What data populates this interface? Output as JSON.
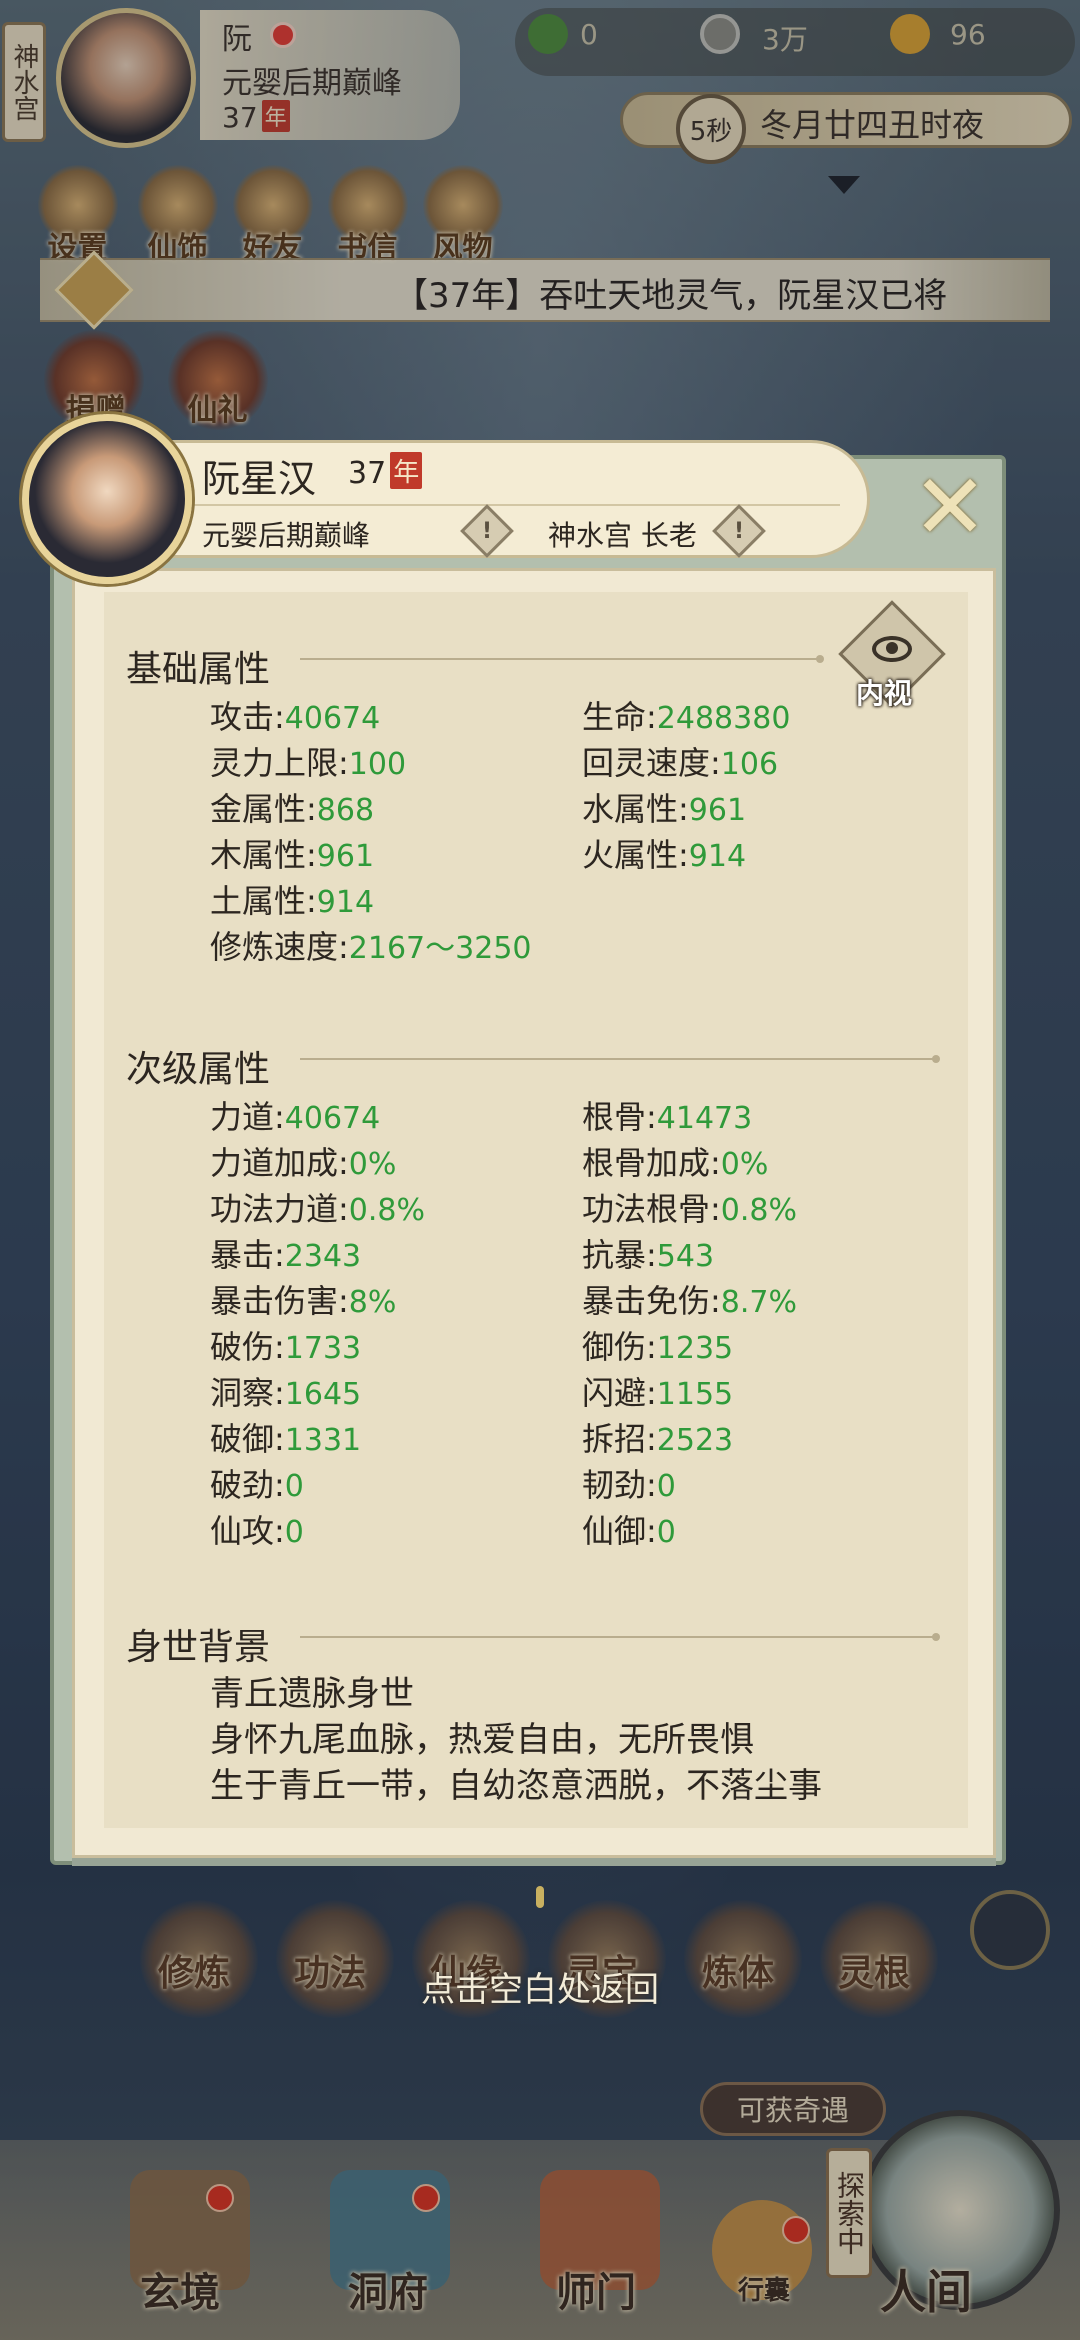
{
  "hud": {
    "sect_short": "神水宫",
    "name": "阮",
    "realm": "元婴后期巅峰",
    "age": "37",
    "age_unit": "年",
    "resources": [
      {
        "icon": "spirit-leaf-icon",
        "value": "0"
      },
      {
        "icon": "coin-icon",
        "value": "3万"
      },
      {
        "icon": "strength-icon",
        "value": "96"
      }
    ],
    "timer": "5秒",
    "date": "冬月廿四丑时夜",
    "menu": [
      "设置",
      "仙饰",
      "好友",
      "书信",
      "风物"
    ],
    "side_menu": [
      "捐赠",
      "仙礼"
    ]
  },
  "news": {
    "text": "【37年】吞吐天地灵气，阮星汉已将"
  },
  "profile": {
    "name": "阮星汉",
    "age": "37",
    "age_unit": "年",
    "realm": "元婴后期巅峰",
    "sect_role": "神水宫 长老",
    "view_inner_label": "内视",
    "basic_title": "基础属性",
    "basic": [
      {
        "label": "攻击",
        "value": "40674"
      },
      {
        "label": "生命",
        "value": "2488380"
      },
      {
        "label": "灵力上限",
        "value": "100"
      },
      {
        "label": "回灵速度",
        "value": "106"
      },
      {
        "label": "金属性",
        "value": "868"
      },
      {
        "label": "水属性",
        "value": "961"
      },
      {
        "label": "木属性",
        "value": "961"
      },
      {
        "label": "火属性",
        "value": "914"
      },
      {
        "label": "土属性",
        "value": "914"
      },
      {
        "label": "修炼速度",
        "value": "2167～3250"
      }
    ],
    "secondary_title": "次级属性",
    "secondary": [
      {
        "label": "力道",
        "value": "40674"
      },
      {
        "label": "根骨",
        "value": "41473"
      },
      {
        "label": "力道加成",
        "value": "0%"
      },
      {
        "label": "根骨加成",
        "value": "0%"
      },
      {
        "label": "功法力道",
        "value": "0.8%"
      },
      {
        "label": "功法根骨",
        "value": "0.8%"
      },
      {
        "label": "暴击",
        "value": "2343"
      },
      {
        "label": "抗暴",
        "value": "543"
      },
      {
        "label": "暴击伤害",
        "value": "8%"
      },
      {
        "label": "暴击免伤",
        "value": "8.7%"
      },
      {
        "label": "破伤",
        "value": "1733"
      },
      {
        "label": "御伤",
        "value": "1235"
      },
      {
        "label": "洞察",
        "value": "1645"
      },
      {
        "label": "闪避",
        "value": "1155"
      },
      {
        "label": "破御",
        "value": "1331"
      },
      {
        "label": "拆招",
        "value": "2523"
      },
      {
        "label": "破劲",
        "value": "0"
      },
      {
        "label": "韧劲",
        "value": "0"
      },
      {
        "label": "仙攻",
        "value": "0"
      },
      {
        "label": "仙御",
        "value": "0"
      }
    ],
    "background_title": "身世背景",
    "background_lines": [
      "青丘遗脉身世",
      "身怀九尾血脉，热爱自由，无所畏惧",
      "生于青丘一带，自幼恣意洒脱，不落尘事"
    ]
  },
  "skills": [
    "修炼",
    "功法",
    "仙缘",
    "灵宝",
    "炼体",
    "灵根"
  ],
  "hint": "点击空白处返回",
  "encounter_label": "可获奇遇",
  "explore_label": "探索中",
  "bottom_nav": [
    "玄境",
    "洞府",
    "师门",
    "行囊",
    "人间"
  ]
}
